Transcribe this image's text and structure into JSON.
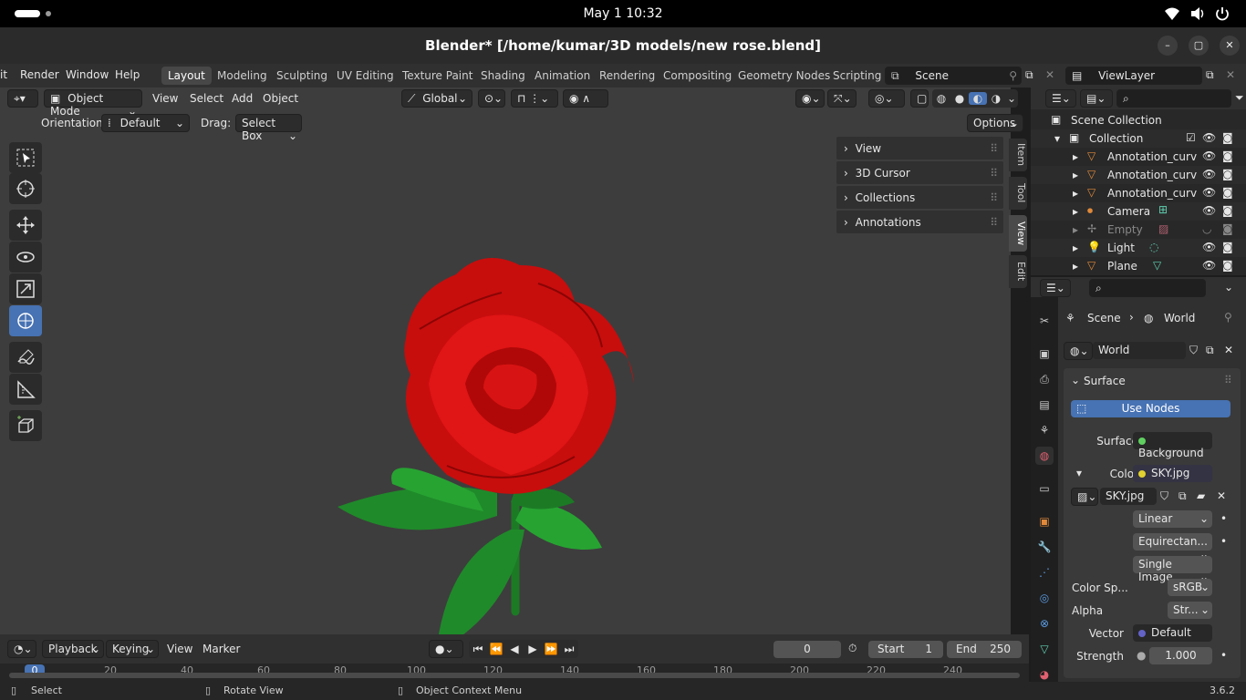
{
  "gnome": {
    "date_time": "May 1  10:32"
  },
  "window": {
    "title": "Blender* [/home/kumar/3D models/new rose.blend]",
    "minimize": "–",
    "maximize": "▢",
    "close": "✕"
  },
  "menubar": {
    "menus": [
      "it",
      "Render",
      "Window",
      "Help"
    ],
    "workspaces": [
      "Layout",
      "Modeling",
      "Sculpting",
      "UV Editing",
      "Texture Paint",
      "Shading",
      "Animation",
      "Rendering",
      "Compositing",
      "Geometry Nodes",
      "Scripting"
    ],
    "scene": "Scene",
    "view_layer": "ViewLayer"
  },
  "viewport": {
    "mode": "Object Mode",
    "menus": [
      "View",
      "Select",
      "Add",
      "Object"
    ],
    "transform": "Global",
    "orientation_label": "Orientation:",
    "orientation_value": "Default",
    "drag_label": "Drag:",
    "drag_value": "Select Box",
    "options": "Options",
    "npanels": [
      "View",
      "3D Cursor",
      "Collections",
      "Annotations"
    ],
    "side_tabs": [
      "Item",
      "Tool",
      "View",
      "Edit"
    ]
  },
  "timeline": {
    "menus": [
      "Playback",
      "Keying",
      "View",
      "Marker"
    ],
    "current_frame": "0",
    "start_label": "Start",
    "start_value": "1",
    "end_label": "End",
    "end_value": "250",
    "ruler": [
      "0",
      "20",
      "40",
      "60",
      "80",
      "100",
      "120",
      "140",
      "160",
      "180",
      "200",
      "220",
      "240"
    ]
  },
  "outliner": {
    "scene_collection": "Scene Collection",
    "collection": "Collection",
    "items": [
      {
        "name": "Annotation_curv",
        "dim": false
      },
      {
        "name": "Annotation_curv",
        "dim": false
      },
      {
        "name": "Annotation_curv",
        "dim": false
      },
      {
        "name": "Camera",
        "dim": false
      },
      {
        "name": "Empty",
        "dim": true
      },
      {
        "name": "Light",
        "dim": false
      },
      {
        "name": "Plane",
        "dim": false
      }
    ]
  },
  "properties": {
    "breadcrumb_scene": "Scene",
    "breadcrumb_world": "World",
    "world_name": "World",
    "surface_panel": "Surface",
    "use_nodes": "Use Nodes",
    "surface_label": "Surface",
    "surface_value": "Background",
    "color_label": "Color",
    "color_value": "SKY.jpg",
    "image_name": "SKY.jpg",
    "interpolation": "Linear",
    "projection": "Equirectan...",
    "source": "Single Image",
    "colorspace_label": "Color Sp...",
    "colorspace_value": "sRGB",
    "alpha_label": "Alpha",
    "alpha_value": "Str...",
    "vector_label": "Vector",
    "vector_value": "Default",
    "strength_label": "Strength",
    "strength_value": "1.000"
  },
  "statusbar": {
    "select": "Select",
    "rotate": "Rotate View",
    "context": "Object Context Menu",
    "version": "3.6.2"
  },
  "colors": {
    "accent": "#4772b3",
    "rose": "#d01010",
    "leaf": "#1f8a2a"
  }
}
